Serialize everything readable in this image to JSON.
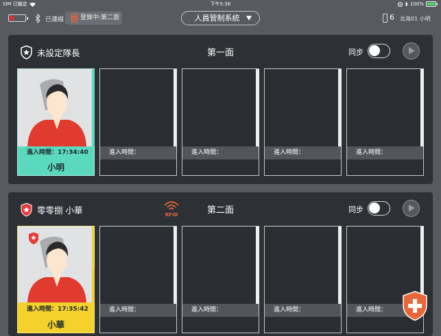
{
  "status_bar": {
    "carrier": "SIM 已鎖定",
    "time": "下午5:36",
    "battery": "100%"
  },
  "top_bar": {
    "connection": "已連線",
    "login_button": "登錄中:第二面",
    "system_select": "人員管制系統",
    "device_count": "6",
    "user": "北海01  小明"
  },
  "panels": [
    {
      "title": "未設定隊長",
      "face": "第一面",
      "sync_label": "同步",
      "sync_on": false,
      "rfid_label": "",
      "slots": [
        {
          "status": "filled",
          "color": "#5bd9bf",
          "time_label": "進入時間：17:34:40",
          "name": "小明"
        },
        {
          "status": "empty",
          "time_label": "進入時間："
        },
        {
          "status": "empty",
          "time_label": "進入時間："
        },
        {
          "status": "empty",
          "time_label": "進入時間："
        },
        {
          "status": "empty",
          "time_label": "進入時間："
        }
      ]
    },
    {
      "title": "零零捌  小華",
      "face": "第二面",
      "sync_label": "同步",
      "sync_on": false,
      "rfid_label": "RFID",
      "slots": [
        {
          "status": "filled",
          "color": "#f4d12b",
          "time_label": "進入時間：17:35:42",
          "name": "小華"
        },
        {
          "status": "empty",
          "time_label": "進入時間："
        },
        {
          "status": "empty",
          "time_label": "進入時間："
        },
        {
          "status": "empty",
          "time_label": "進入時間："
        },
        {
          "status": "empty",
          "time_label": "進入時間："
        }
      ]
    }
  ],
  "colors": {
    "battery_low": "#e32d2d",
    "accent_green": "#5bd9bf",
    "accent_yellow": "#f4d12b",
    "rfid_orange": "#e8673a",
    "alert_orange": "#e8673a"
  },
  "icons": [
    "battery-icon",
    "bluetooth-icon",
    "stack-icon",
    "phone-icon",
    "badge-star-icon",
    "rfid-icon",
    "play-icon",
    "shield-plus-icon"
  ]
}
